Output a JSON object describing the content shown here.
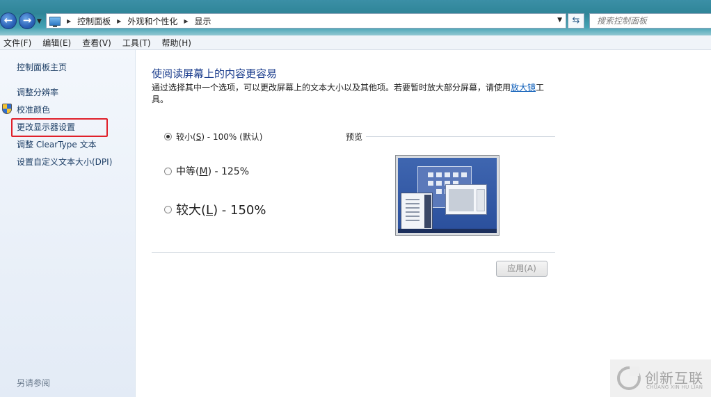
{
  "address_bar": {
    "breadcrumbs": [
      "控制面板",
      "外观和个性化",
      "显示"
    ],
    "search_placeholder": "搜索控制面板"
  },
  "menu": {
    "items": [
      "文件(F)",
      "编辑(E)",
      "查看(V)",
      "工具(T)",
      "帮助(H)"
    ]
  },
  "sidebar": {
    "home": "控制面板主页",
    "links": [
      "调整分辨率",
      "校准颜色",
      "更改显示器设置",
      "调整 ClearType 文本",
      "设置自定义文本大小(DPI)"
    ],
    "highlighted": "更改显示器设置",
    "see_also": "另请参阅"
  },
  "main": {
    "title": "使阅读屏幕上的内容更容易",
    "description_prefix": "通过选择其中一个选项，可以更改屏幕上的文本大小以及其他项。若要暂时放大部分屏幕，请使用",
    "description_link": "放大镜",
    "description_suffix": "工具。",
    "options": [
      {
        "label_pre": "较小(",
        "key": "S",
        "label_post": ") - 100% (默认)",
        "selected": true
      },
      {
        "label_pre": "中等(",
        "key": "M",
        "label_post": ") - 125%",
        "selected": false
      },
      {
        "label_pre": "较大(",
        "key": "L",
        "label_post": ") - 150%",
        "selected": false
      }
    ],
    "preview_label": "预览",
    "apply_label": "应用(A)"
  },
  "watermark": {
    "text": "创新互联",
    "subtext": "CHUANG XIN HU LIAN"
  },
  "colors": {
    "title_blue": "#1a3c8c",
    "link_blue": "#0b5cb8",
    "highlight_red": "#e0202a"
  }
}
